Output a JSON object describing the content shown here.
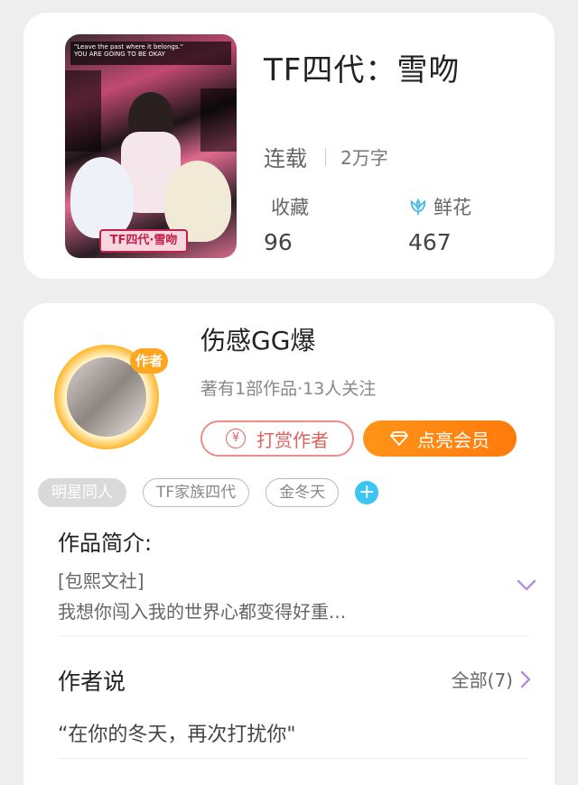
{
  "book": {
    "title": "TF四代：雪吻",
    "cover_quote": "\"Leave the past where it belongs.\"",
    "cover_sub": "YOU ARE GOING TO BE OKAY",
    "cover_title": "TF四代·雪吻",
    "status": "连载",
    "word_count": "2万字",
    "collect_label": "收藏",
    "collect_value": "96",
    "flower_label": "鲜花",
    "flower_value": "467",
    "flower_icon": "tulip-icon"
  },
  "author": {
    "name": "伤感GG爆",
    "badge": "作者",
    "meta": "著有1部作品·13人关注",
    "tip_label": "打赏作者",
    "tip_icon": "¥",
    "vip_label": "点亮会员",
    "vip_icon": "diamond-icon"
  },
  "tags": [
    "明星同人",
    "TF家族四代",
    "金冬天"
  ],
  "intro": {
    "title": "作品简介:",
    "lines": [
      "[包熙文社]",
      "我想你闯入我的世界心都变得好重..."
    ]
  },
  "author_say": {
    "title": "作者说",
    "all_label": "全部(7)",
    "quote": "“在你的冬天，再次打扰你\""
  },
  "colors": {
    "accent_orange": "#ff8a14",
    "tip_red": "#e06060",
    "chevron_purple": "#b58ce0",
    "plus_blue": "#39c6f2"
  }
}
